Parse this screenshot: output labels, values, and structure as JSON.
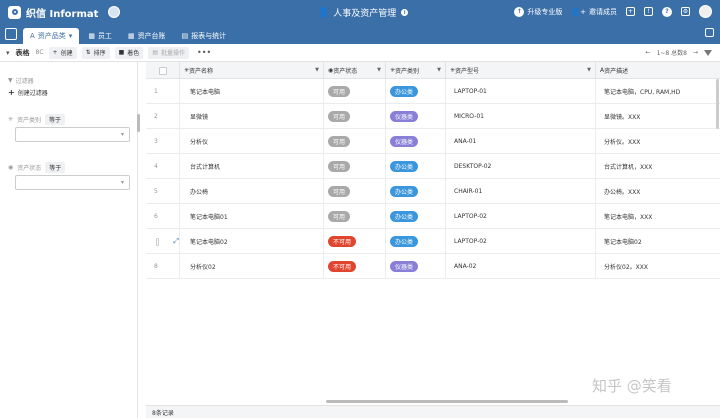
{
  "app": {
    "brand": "织信 Informat",
    "title": "人事及资产管理",
    "upgrade_label": "升级专业版",
    "invite_label": "邀请成员"
  },
  "tabs": [
    {
      "label": "资产品类",
      "icon": "type-icon",
      "active": true
    },
    {
      "label": "员工",
      "icon": "table-icon",
      "active": false
    },
    {
      "label": "资产台账",
      "icon": "table-icon",
      "active": false
    },
    {
      "label": "报表与统计",
      "icon": "chart-icon",
      "active": false
    }
  ],
  "toolbar": {
    "view_label": "表格",
    "view_count": "8C",
    "create_label": "创建",
    "sort_label": "排序",
    "color_label": "着色",
    "batch_label": "批量操作",
    "more_label": "•••",
    "pagination": "1~8 总数8"
  },
  "sidebar": {
    "filter_label": "过滤器",
    "create_filter_label": "创建过滤器",
    "filters": [
      {
        "label": "资产类别",
        "operator": "等于",
        "value": ""
      },
      {
        "label": "资产状态",
        "operator": "等于",
        "value": ""
      }
    ]
  },
  "grid": {
    "columns": [
      "资产名称",
      "资产状态",
      "资产类别",
      "资产型号",
      "资产描述"
    ],
    "rows": [
      {
        "num": "1",
        "name": "笔记本电脑",
        "status": "可用",
        "status_color": "gray",
        "category": "办公类",
        "category_color": "blue",
        "model": "LAPTOP-01",
        "desc": "笔记本电脑，CPU, RAM,HD"
      },
      {
        "num": "2",
        "name": "显微镜",
        "status": "可用",
        "status_color": "gray",
        "category": "仪器类",
        "category_color": "purple",
        "model": "MICRO-01",
        "desc": "显微镜。XXX"
      },
      {
        "num": "3",
        "name": "分析仪",
        "status": "可用",
        "status_color": "gray",
        "category": "仪器类",
        "category_color": "purple",
        "model": "ANA-01",
        "desc": "分析仪。XXX"
      },
      {
        "num": "4",
        "name": "台式计算机",
        "status": "可用",
        "status_color": "gray",
        "category": "办公类",
        "category_color": "blue",
        "model": "DESKTOP-02",
        "desc": "台式计算机，XXX"
      },
      {
        "num": "5",
        "name": "办公椅",
        "status": "可用",
        "status_color": "gray",
        "category": "办公类",
        "category_color": "blue",
        "model": "CHAIR-01",
        "desc": "办公椅。XXX"
      },
      {
        "num": "6",
        "name": "笔记本电脑01",
        "status": "可用",
        "status_color": "gray",
        "category": "办公类",
        "category_color": "blue",
        "model": "LAPTOP-02",
        "desc": "笔记本电脑，XXX"
      },
      {
        "num": "",
        "name": "笔记本电脑02",
        "status": "不可用",
        "status_color": "red",
        "category": "办公类",
        "category_color": "blue",
        "model": "LAPTOP-02",
        "desc": "笔记本电脑02"
      },
      {
        "num": "8",
        "name": "分析仪02",
        "status": "不可用",
        "status_color": "red",
        "category": "仪器类",
        "category_color": "purple",
        "model": "ANA-02",
        "desc": "分析仪02。XXX"
      }
    ],
    "footer": "8条记录"
  },
  "watermark": "知乎 @笑看",
  "colors": {
    "primary": "#3a6fa8",
    "red": "#e0452f",
    "blue": "#3a96dd",
    "purple": "#8a7fd6",
    "gray": "#a9a9a9"
  }
}
